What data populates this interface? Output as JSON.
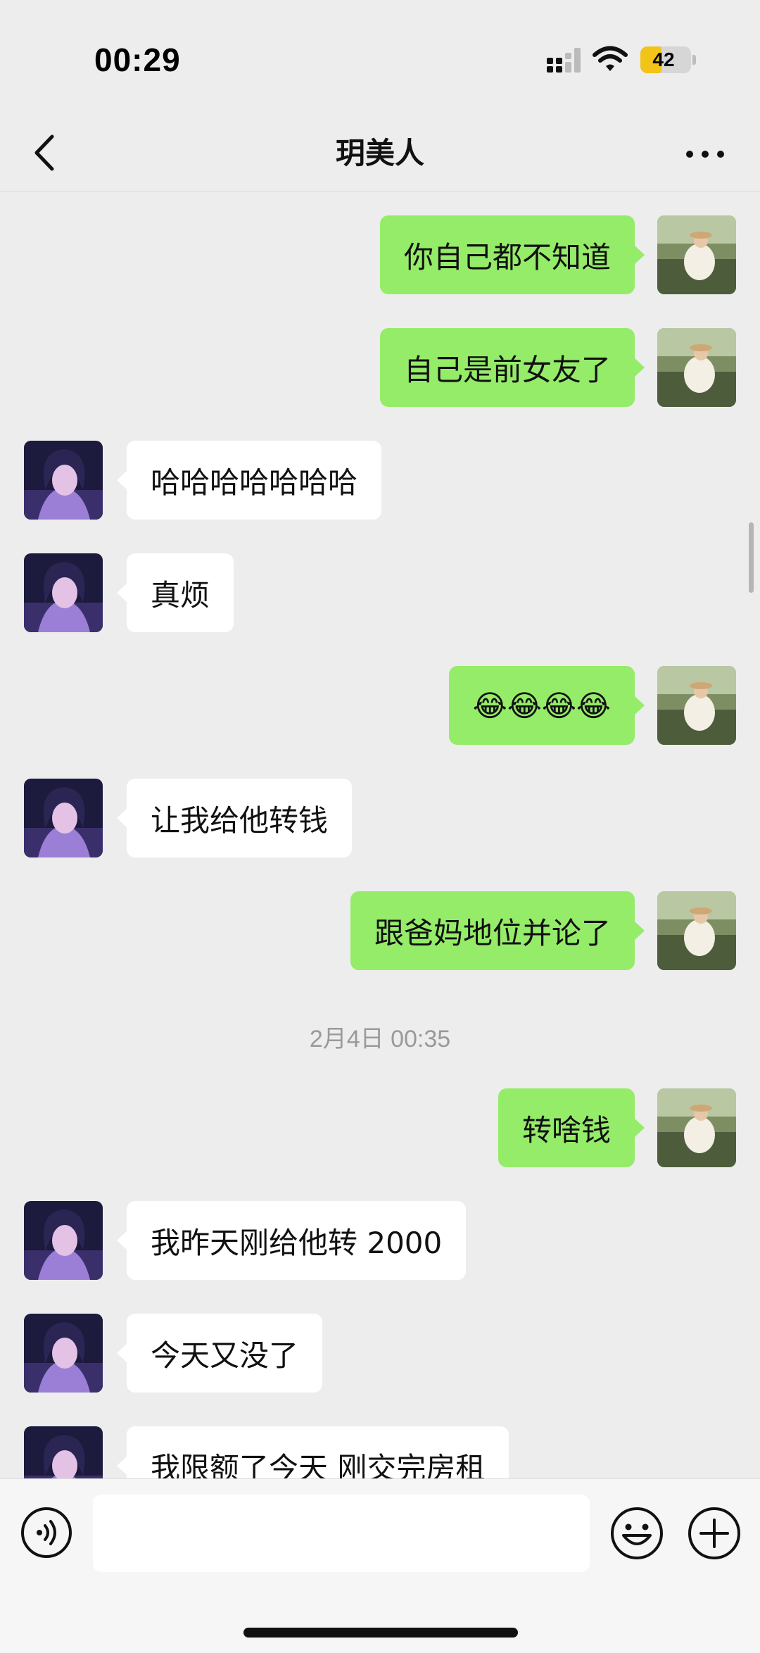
{
  "status_bar": {
    "time": "00:29",
    "battery": "42",
    "battery_level": 0.42
  },
  "nav": {
    "title": "玥美人",
    "back_icon": "chevron-left-icon",
    "more_icon": "more-dots-icon"
  },
  "messages": [
    {
      "sender": "me",
      "text": "你自己都不知道"
    },
    {
      "sender": "me",
      "text": "自己是前女友了"
    },
    {
      "sender": "other",
      "text": "哈哈哈哈哈哈哈"
    },
    {
      "sender": "other",
      "text": "真烦"
    },
    {
      "sender": "me",
      "text": "😂😂😂😂"
    },
    {
      "sender": "other",
      "text": "让我给他转钱"
    },
    {
      "sender": "me",
      "text": "跟爸妈地位并论了"
    },
    {
      "timestamp": "2月4日 00:35"
    },
    {
      "sender": "me",
      "text": "转啥钱"
    },
    {
      "sender": "other",
      "text": "我昨天刚给他转 2000"
    },
    {
      "sender": "other",
      "text": "今天又没了"
    },
    {
      "sender": "other",
      "text": "我限额了今天 刚交完房租"
    }
  ],
  "input_bar": {
    "voice_icon": "voice-icon",
    "emoji_icon": "emoji-icon",
    "plus_icon": "plus-circle-icon",
    "input_value": ""
  },
  "colors": {
    "me_bubble": "#95ec69",
    "other_bubble": "#ffffff",
    "background": "#ededed"
  }
}
